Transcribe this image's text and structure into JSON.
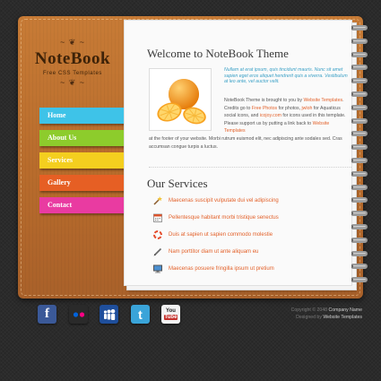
{
  "brand": {
    "title": "NoteBook",
    "subtitle": "Free CSS Templates"
  },
  "nav": [
    {
      "label": "Home",
      "color": "#3ec3e8"
    },
    {
      "label": "About Us",
      "color": "#8dcc2c"
    },
    {
      "label": "Services",
      "color": "#f4cf1f"
    },
    {
      "label": "Gallery",
      "color": "#e65f24"
    },
    {
      "label": "Contact",
      "color": "#e93ba1"
    }
  ],
  "welcome": {
    "title": "Welcome to NoteBook Theme",
    "intro": "Nullam at erat ipsum, quis tincidunt mauris. Nunc sit amet sapien eget eros aliquet hendrerit quis a viverra. Vestibulum at leo ante, vel auctor velit.",
    "p1_a": "NoteBook Theme is brought to you by ",
    "p1_link1": "Website Templates",
    "p1_b": ". Credits go to ",
    "p1_link2": "Free Photos",
    "p1_c": " for photos, ",
    "p1_link3": "jwloh",
    "p1_d": " for Aquaticus social icons, and ",
    "p1_link4": "icojoy.com",
    "p1_e": " for icons used in this template. Please support us by putting a link back to ",
    "p1_link5": "Website Templates",
    "p1_f": " at the footer of your website. Morbi rutrum euismod elit, nec adipiscing ante sodales sed. Cras accumsan congue turpis a luctus."
  },
  "services": {
    "title": "Our Services",
    "items": [
      {
        "label": "Maecenas suscipit vulputate dui vel adipiscing",
        "icon": "magic-wand-icon"
      },
      {
        "label": "Pellentesque habitant morbi tristique senectus",
        "icon": "calendar-icon"
      },
      {
        "label": "Duis at sapien ut sapien commodo molestie",
        "icon": "lifebuoy-icon"
      },
      {
        "label": "Nam porttitor diam ut ante aliquam eu",
        "icon": "pen-icon"
      },
      {
        "label": "Maecenas posuere fringilla ipsum ut pretium",
        "icon": "monitor-icon"
      }
    ]
  },
  "social": [
    {
      "name": "facebook-icon",
      "glyph": "f",
      "color": "#3b5998"
    },
    {
      "name": "flickr-icon",
      "glyph": "••",
      "color": "#2a2a2a"
    },
    {
      "name": "myspace-icon",
      "glyph": "⁂",
      "color": "#1f4f9c"
    },
    {
      "name": "twitter-icon",
      "glyph": "t",
      "color": "#3aa4d9"
    },
    {
      "name": "youtube-icon",
      "glyph": "You",
      "color": "#c4302b"
    }
  ],
  "footer": {
    "copyright_pre": "Copyright © 2048 ",
    "company": "Company Name",
    "designed_pre": "Designed by ",
    "designer": "Website Templates"
  }
}
